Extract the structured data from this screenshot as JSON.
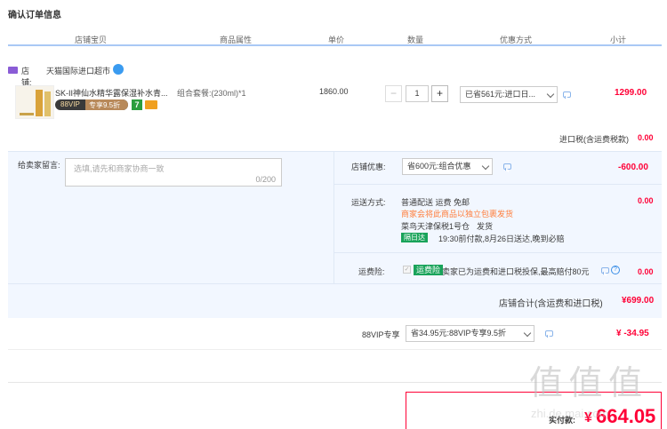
{
  "page_title": "确认订单信息",
  "columns": [
    "店铺宝贝",
    "商品属性",
    "单价",
    "数量",
    "优惠方式",
    "小计"
  ],
  "shop": {
    "label": "店铺:",
    "name": "天猫国际进口超市"
  },
  "item": {
    "title": "SK-II神仙水精华露保湿补水青...",
    "vip_badge_left": "88VIP",
    "vip_badge_right": "专享9.5折",
    "badge_7": "7",
    "attr": "组合套餐:(230ml)*1",
    "price": "1860.00",
    "quantity": "1",
    "discount": "已省561元:进口日...",
    "subtotal": "1299.00"
  },
  "tax": {
    "label": "进口税(含运费税款)",
    "value": "0.00"
  },
  "message": {
    "label": "给卖家留言:",
    "placeholder": "选填,请先和商家协商一致",
    "counter": "0/200"
  },
  "shop_discount": {
    "label": "店铺优惠:",
    "select": "省600元:组合优惠",
    "value": "-600.00"
  },
  "shipping": {
    "label": "运送方式:",
    "method": "普通配送 运费 免邮",
    "note": "商家会将此商品以独立包裹发货",
    "warehouse": "菜鸟天津保税1号仓",
    "warehouse_action": "发货",
    "tag": "隔日达",
    "eta": "19:30前付款,8月26日送达,晚到必赔",
    "value": "0.00"
  },
  "insurance": {
    "label": "运费险:",
    "tag": "运费险",
    "desc": "卖家已为运费和进口税投保,最高赔付80元",
    "value": "0.00"
  },
  "shop_total": {
    "label": "店铺合计(含运费和进口税)",
    "value": "¥699.00"
  },
  "vip88": {
    "label": "88VIP专享",
    "select": "省34.95元:88VIP专享9.5折",
    "value": "¥ -34.95"
  },
  "final": {
    "label": "实付款:",
    "value": "664.05"
  },
  "watermark": "值 值 值",
  "watermark_url": "zhi.de.mai.com",
  "colors": {
    "accent": "#ff0036",
    "blue": "#a9c8f5",
    "panel": "#f2f7ff"
  }
}
